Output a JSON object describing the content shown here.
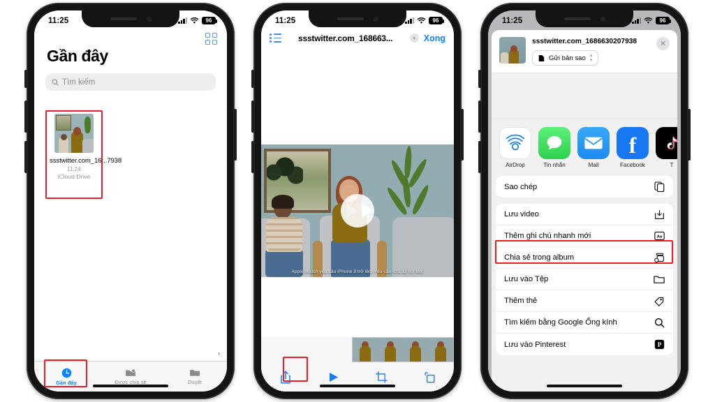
{
  "status": {
    "time": "11:25",
    "battery": "96",
    "signal_icon": "cellular-bars-icon",
    "wifi_icon": "wifi-icon"
  },
  "phone1": {
    "grid_icon": "grid-view-icon",
    "title": "Gần đây",
    "search": {
      "placeholder": "Tìm kiếm",
      "icon": "search-icon"
    },
    "file": {
      "name": "ssstwitter.com_16...7938",
      "time": "11:24",
      "source": "iCloud Drive"
    },
    "tabs": [
      {
        "label": "Gần đây",
        "icon": "clock-icon",
        "active": true
      },
      {
        "label": "Được chia sẻ",
        "icon": "shared-folder-icon",
        "active": false
      },
      {
        "label": "Duyệt",
        "icon": "folder-icon",
        "active": false
      }
    ],
    "scroll_caret": "›"
  },
  "phone2": {
    "nav": {
      "list_icon": "list-bullet-icon",
      "title": "ssstwitter.com_168663...",
      "chevron_icon": "chevron-down-icon",
      "done_label": "Xong"
    },
    "video": {
      "play_icon": "play-circle-icon",
      "caption": "Apple Watch yêu cầu iPhone 8 trở lên. Yêu cầu iOS 12 trở lên."
    },
    "toolbar": [
      {
        "icon": "share-icon",
        "highlighted": true
      },
      {
        "icon": "play-icon",
        "highlighted": false
      },
      {
        "icon": "crop-icon",
        "highlighted": false
      },
      {
        "icon": "rotate-icon",
        "highlighted": false
      }
    ]
  },
  "phone3": {
    "header": {
      "filename": "ssstwitter.com_1686630207938",
      "option_label": "Gửi bản sao",
      "option_icon": "document-icon",
      "stepper_icon": "updown-chevron-icon",
      "close_icon": "close-icon"
    },
    "apps": [
      {
        "label": "AirDrop",
        "icon": "airdrop-icon",
        "color": "#ffffff"
      },
      {
        "label": "Tin nhắn",
        "icon": "messages-icon",
        "color": "#4cd964"
      },
      {
        "label": "Mail",
        "icon": "mail-icon",
        "color": "#2a9cf5"
      },
      {
        "label": "Facebook",
        "icon": "facebook-icon",
        "color": "#1877f2"
      },
      {
        "label": "T",
        "icon": "tiktok-icon",
        "color": "#000000"
      }
    ],
    "menu_group1": [
      {
        "label": "Sao chép",
        "icon": "copy-icon",
        "highlighted": false
      }
    ],
    "menu_group2": [
      {
        "label": "Lưu video",
        "icon": "save-download-icon",
        "highlighted": true
      },
      {
        "label": "Thêm ghi chú nhanh mới",
        "icon": "quick-note-icon",
        "highlighted": false
      },
      {
        "label": "Chia sẻ trong album",
        "icon": "shared-album-icon",
        "highlighted": false
      },
      {
        "label": "Lưu vào Tệp",
        "icon": "folder-icon",
        "highlighted": false
      },
      {
        "label": "Thêm thẻ",
        "icon": "tag-icon",
        "highlighted": false
      },
      {
        "label": "Tìm kiếm bằng Google Ống kính",
        "icon": "search-icon",
        "highlighted": false
      },
      {
        "label": "Lưu vào Pinterest",
        "icon": "pinterest-icon",
        "highlighted": false
      }
    ]
  },
  "colors": {
    "highlight": "#ED1C24",
    "accent_blue": "#0a84ff"
  }
}
